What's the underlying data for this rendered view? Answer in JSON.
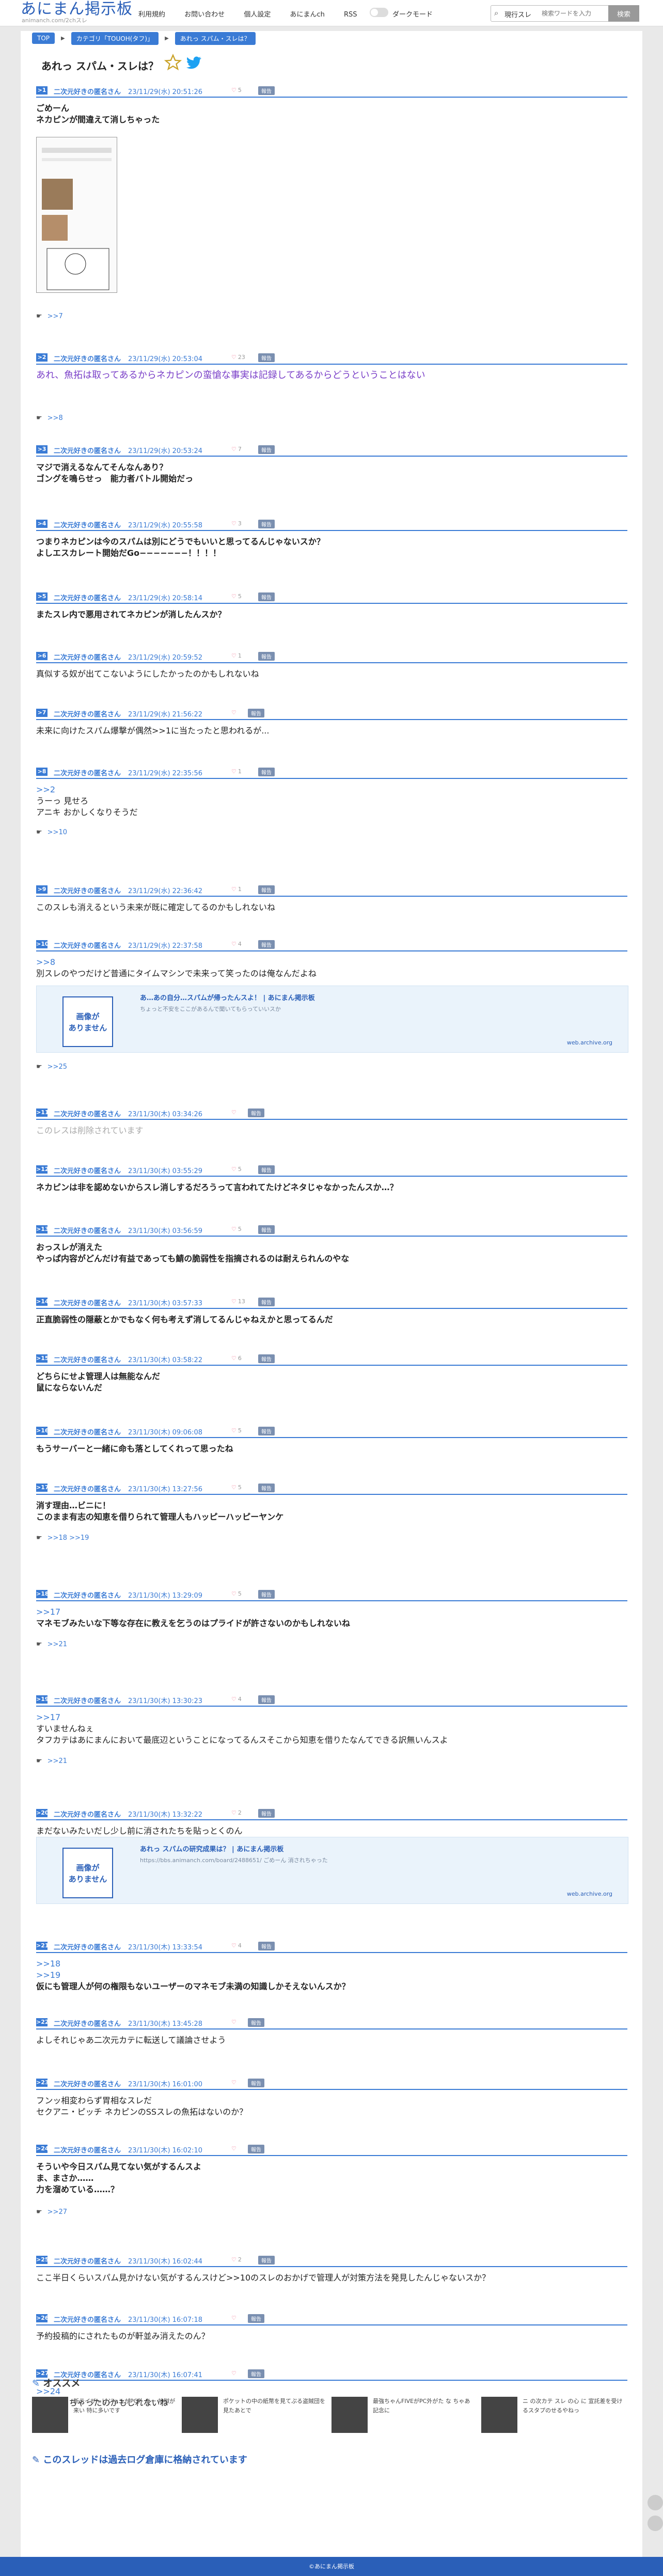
{
  "header": {
    "logo": "あにまん掲示板",
    "logo_sub": "animanch.com/2chスレ",
    "nav": [
      "利用規約",
      "お問い合わせ",
      "個人設定",
      "あにまんch",
      "RSS"
    ],
    "dark_mode_label": "ダークモード",
    "search_scope": "現行スレ",
    "search_placeholder": "検索ワードを入力",
    "search_button": "検索"
  },
  "breadcrumb": [
    "TOP",
    "カテゴリ「TOUOH(タフ)」",
    "あれっ スパム・スレは？"
  ],
  "thread_title": "あれっ スパム・スレは？",
  "posts": [
    {
      "num": ">1",
      "name": "二次元好きの匿名さん",
      "date": "23/11/29(水) 20:51:26",
      "likes": "5",
      "lines": [
        "ごめーん",
        "ネカピンが間違えて消しちゃった"
      ],
      "reply": ">>7"
    },
    {
      "num": ">2",
      "name": "二次元好きの匿名さん",
      "date": "23/11/29(水) 20:53:04",
      "likes": "23",
      "lines": [
        "あれ、魚拓は取ってあるからネカピンの蛮愴な事実は記録してあるからどうということはない"
      ],
      "reply": ">>8"
    },
    {
      "num": ">3",
      "name": "二次元好きの匿名さん",
      "date": "23/11/29(水) 20:53:24",
      "likes": "7",
      "lines": [
        "マジで消えるなんてそんなんあり？",
        "ゴングを鳴らせっ　能力者バトル開始だっ"
      ]
    },
    {
      "num": ">4",
      "name": "二次元好きの匿名さん",
      "date": "23/11/29(水) 20:55:58",
      "likes": "3",
      "lines": [
        "つまりネカピンは今のスパムは別にどうでもいいと思ってるんじゃないスか？",
        "よしエスカレート開始だGo−−−−−−−！！！！"
      ]
    },
    {
      "num": ">5",
      "name": "二次元好きの匿名さん",
      "date": "23/11/29(水) 20:58:14",
      "likes": "5",
      "lines": [
        "またスレ内で悪用されてネカピンが消したんスか？"
      ]
    },
    {
      "num": ">6",
      "name": "二次元好きの匿名さん",
      "date": "23/11/29(水) 20:59:52",
      "likes": "1",
      "lines": [
        "真似する奴が出てこないようにしたかったのかもしれないね"
      ]
    },
    {
      "num": ">7",
      "name": "二次元好きの匿名さん",
      "date": "23/11/29(水) 21:56:22",
      "likes": "",
      "lines": [
        "未来に向けたスパム爆撃が偶然>>1に当たったと思われるが..."
      ]
    },
    {
      "num": ">8",
      "name": "二次元好きの匿名さん",
      "date": "23/11/29(水) 22:35:56",
      "likes": "1",
      "lines": [
        ">>2",
        "うーっ 見せろ",
        "アニキ おかしくなりそうだ"
      ],
      "reply": ">>10"
    },
    {
      "num": ">9",
      "name": "二次元好きの匿名さん",
      "date": "23/11/29(水) 22:36:42",
      "likes": "1",
      "lines": [
        "このスレも消えるという未来が既に確定してるのかもしれないね"
      ]
    },
    {
      "num": ">10",
      "name": "二次元好きの匿名さん",
      "date": "23/11/29(水) 22:37:58",
      "likes": "4",
      "lines": [
        ">>8",
        "別スレのやつだけど普通にタイムマシンで未来って笑ったのは俺なんだよね"
      ],
      "reply": ">>25"
    },
    {
      "num": ">11",
      "name": "二次元好きの匿名さん",
      "date": "23/11/30(木) 03:34:26",
      "likes": "",
      "lines": [
        "このレスは削除されています"
      ]
    },
    {
      "num": ">12",
      "name": "二次元好きの匿名さん",
      "date": "23/11/30(木) 03:55:29",
      "likes": "5",
      "lines": [
        "ネカピンは非を認めないからスレ消しするだろうって言われてたけどネタじゃなかったんスか…？"
      ]
    },
    {
      "num": ">13",
      "name": "二次元好きの匿名さん",
      "date": "23/11/30(木) 03:56:59",
      "likes": "5",
      "lines": [
        "おっスレが消えた",
        "やっぱ内容がどんだけ有益であっても鯖の脆弱性を指摘されるのは耐えられんのやな"
      ]
    },
    {
      "num": ">14",
      "name": "二次元好きの匿名さん",
      "date": "23/11/30(木) 03:57:33",
      "likes": "13",
      "lines": [
        "正直脆弱性の隠蔽とかでもなく何も考えず消してるんじゃねえかと思ってるんだ"
      ]
    },
    {
      "num": ">15",
      "name": "二次元好きの匿名さん",
      "date": "23/11/30(木) 03:58:22",
      "likes": "6",
      "lines": [
        "どちらにせよ管理人は無能なんだ",
        "鼠にならないんだ"
      ]
    },
    {
      "num": ">16",
      "name": "二次元好きの匿名さん",
      "date": "23/11/30(木) 09:06:08",
      "likes": "5",
      "lines": [
        "もうサーバーと一緒に命も落としてくれって思ったね"
      ]
    },
    {
      "num": ">17",
      "name": "二次元好きの匿名さん",
      "date": "23/11/30(木) 13:27:56",
      "likes": "5",
      "lines": [
        "消す理由…ビニに！",
        "このまま有志の知恵を借りられて管理人もハッピーハッピーヤンケ"
      ],
      "reply": ">>18 >>19"
    },
    {
      "num": ">18",
      "name": "二次元好きの匿名さん",
      "date": "23/11/30(木) 13:29:09",
      "likes": "5",
      "lines": [
        ">>17",
        "マネモブみたいな下等な存在に教えを乞うのはプライドが許さないのかもしれないね"
      ],
      "reply": ">>21"
    },
    {
      "num": ">19",
      "name": "二次元好きの匿名さん",
      "date": "23/11/30(木) 13:30:23",
      "likes": "4",
      "lines": [
        ">>17",
        "すいませんねぇ",
        "タフカテはあにまんにおいて最底辺ということになってるんスそこから知恵を借りたなんてできる訳無いんスよ"
      ],
      "reply": ">>21"
    },
    {
      "num": ">20",
      "name": "二次元好きの匿名さん",
      "date": "23/11/30(木) 13:32:22",
      "likes": "2",
      "lines": [
        "まだないみたいだし少し前に消されたちを貼っとくのん"
      ]
    },
    {
      "num": ">21",
      "name": "二次元好きの匿名さん",
      "date": "23/11/30(木) 13:33:54",
      "likes": "4",
      "lines": [
        ">>18",
        ">>19",
        "仮にも管理人が何の権限もないユーザーのマネモブ未満の知識しかそえないんスか？"
      ]
    },
    {
      "num": ">22",
      "name": "二次元好きの匿名さん",
      "date": "23/11/30(木) 13:45:28",
      "likes": "",
      "lines": [
        "よしそれじゃあ二次元カテに転送して議論させよう"
      ]
    },
    {
      "num": ">23",
      "name": "二次元好きの匿名さん",
      "date": "23/11/30(木) 16:01:00",
      "likes": "",
      "lines": [
        "フンッ相変わらず胃相なスレだ",
        "セクアニ・ピッチ ネカピンのSSスレの魚拓はないのか？"
      ]
    },
    {
      "num": ">24",
      "name": "二次元好きの匿名さん",
      "date": "23/11/30(木) 16:02:10",
      "likes": "",
      "lines": [
        "そういや今日スパム見てない気がするんスよ",
        "ま、まさか……",
        "力を溜めている……？"
      ],
      "reply": ">>27"
    },
    {
      "num": ">25",
      "name": "二次元好きの匿名さん",
      "date": "23/11/30(木) 16:02:44",
      "likes": "2",
      "lines": [
        "ここ半日くらいスパム見かけない気がするんスけど>>10のスレのおかげで管理人が対策方法を発見したんじゃないスか？"
      ]
    },
    {
      "num": ">26",
      "name": "二次元好きの匿名さん",
      "date": "23/11/30(木) 16:07:18",
      "likes": "",
      "lines": [
        "予約投稿的にされたものが軒並み消えたのん？"
      ]
    },
    {
      "num": ">27",
      "name": "二次元好きの匿名さん",
      "date": "23/11/30(木) 16:07:41",
      "likes": "",
      "lines": [
        ">>24",
        "もう飽きちゃったのかもしれないね"
      ]
    }
  ],
  "embeds": [
    {
      "image_label": "画像が\nありません",
      "title": "あ…あの自分…スパムが帰ったんスよ！ | あにまん掲示板",
      "desc": "ちょっと不安をここがあるんで聞いてもらっていいスか",
      "host": "web.archive.org"
    },
    {
      "image_label": "画像が\nありません",
      "title": "あれっ スパムの研究成果は？ | あにまん掲示板",
      "desc": "https://bbs.animanch.com/board/2488651/ ごめーん 消されちゃった",
      "host": "web.archive.org"
    }
  ],
  "recommend": {
    "title": "オススメ",
    "items": [
      "新テイザービジョンがPC外 あー 地獄が来い 特に多いです",
      "ポケットの中の紙幣を見てぷる盗賊団を見たあとで",
      "最強ちゃんFIVEがPC外がた な ちゃあ 記念に",
      "ニ の次カテ スレ の心 に 宣託差を受けるスタプのせるやねっ"
    ]
  },
  "log_notice": "このスレッドは過去ログ倉庫に格納されています",
  "footer": "©あにまん掲示板"
}
